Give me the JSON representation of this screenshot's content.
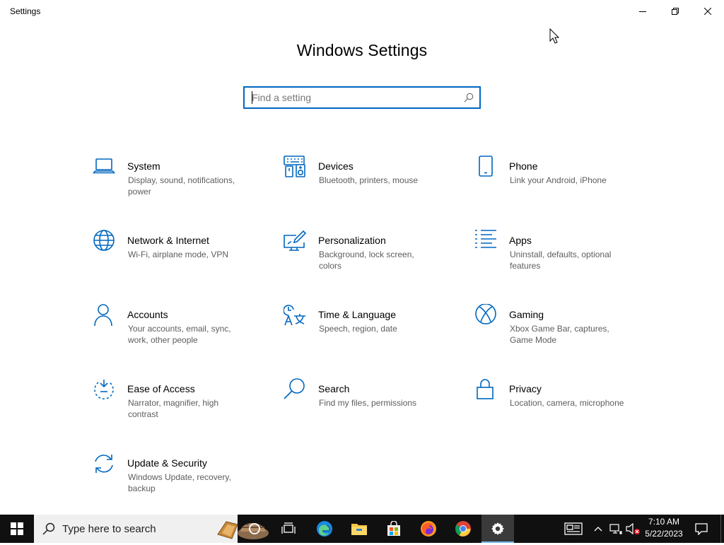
{
  "window": {
    "title": "Settings"
  },
  "heading": "Windows Settings",
  "search": {
    "placeholder": "Find a setting"
  },
  "tiles": [
    {
      "name": "System",
      "desc": "Display, sound, notifications, power",
      "icon": "laptop-icon"
    },
    {
      "name": "Devices",
      "desc": "Bluetooth, printers, mouse",
      "icon": "keyboard-speaker-icon"
    },
    {
      "name": "Phone",
      "desc": "Link your Android, iPhone",
      "icon": "phone-icon"
    },
    {
      "name": "Network & Internet",
      "desc": "Wi-Fi, airplane mode, VPN",
      "icon": "globe-icon"
    },
    {
      "name": "Personalization",
      "desc": "Background, lock screen, colors",
      "icon": "paint-monitor-icon"
    },
    {
      "name": "Apps",
      "desc": "Uninstall, defaults, optional features",
      "icon": "apps-list-icon"
    },
    {
      "name": "Accounts",
      "desc": "Your accounts, email, sync, work, other people",
      "icon": "person-icon"
    },
    {
      "name": "Time & Language",
      "desc": "Speech, region, date",
      "icon": "time-language-icon"
    },
    {
      "name": "Gaming",
      "desc": "Xbox Game Bar, captures, Game Mode",
      "icon": "xbox-icon"
    },
    {
      "name": "Ease of Access",
      "desc": "Narrator, magnifier, high contrast",
      "icon": "ease-of-access-icon"
    },
    {
      "name": "Search",
      "desc": "Find my files, permissions",
      "icon": "magnifier-icon"
    },
    {
      "name": "Privacy",
      "desc": "Location, camera, microphone",
      "icon": "lock-icon"
    },
    {
      "name": "Update & Security",
      "desc": "Windows Update, recovery, backup",
      "icon": "sync-arrows-icon"
    }
  ],
  "taskbar": {
    "search_placeholder": "Type here to search",
    "time": "7:10 AM",
    "date": "5/22/2023"
  },
  "colors": {
    "accent": "#0067c0",
    "taskbar": "#101010"
  }
}
